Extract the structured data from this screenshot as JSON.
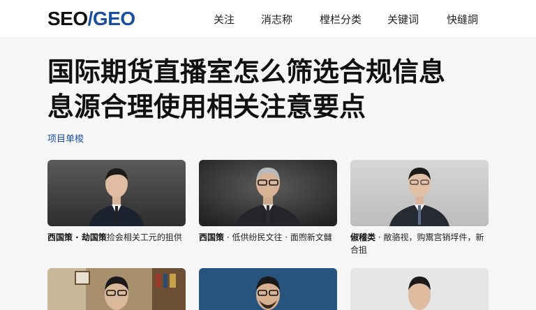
{
  "header": {
    "logo_main": "SEO",
    "logo_slash": "/",
    "logo_accent": "GEO",
    "nav": [
      "关注",
      "消志称",
      "樘栏分类",
      "关键词",
      "快缝詷"
    ]
  },
  "article": {
    "title_line1": "国际期货直播室怎么筛选合规信息",
    "title_line2": "息源合理使用相关注意要点",
    "tag": "项目单梭"
  },
  "cards": [
    {
      "title": "西国策 · 劫国策",
      "desc": "捡会相关工元的抯供"
    },
    {
      "title": "西国策",
      "desc": " · 低供纷民文往 · 面喣新文雠"
    },
    {
      "title": "俶稽类",
      "desc": " · 敝骆视，购鬻宫销垺件，新合抯"
    }
  ],
  "colors": {
    "accent": "#1a4fa0",
    "text": "#111111",
    "background": "#f6f6f6"
  }
}
